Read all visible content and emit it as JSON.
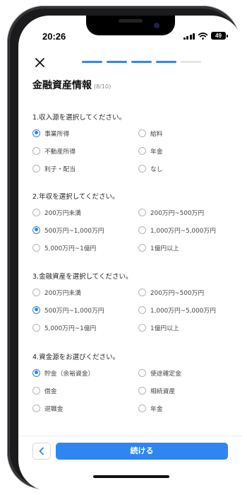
{
  "status_bar": {
    "time": "20:26",
    "battery": "49"
  },
  "header": {
    "title": "金融資産情報",
    "step_counter": "(8/10)",
    "progress": {
      "total_segments": 5,
      "completed_segments": 4
    }
  },
  "colors": {
    "accent": "#2f86f0",
    "segment_inactive": "#e4e4e4"
  },
  "sections": [
    {
      "title": "1.収入源を選択してください。",
      "options": [
        {
          "label": "事業所得",
          "selected": true
        },
        {
          "label": "給料",
          "selected": false
        },
        {
          "label": "不動産所得",
          "selected": false
        },
        {
          "label": "年金",
          "selected": false
        },
        {
          "label": "利子・配当",
          "selected": false
        },
        {
          "label": "なし",
          "selected": false
        }
      ]
    },
    {
      "title": "2.年収を選択してください。",
      "options": [
        {
          "label": "200万円未満",
          "selected": false
        },
        {
          "label": "200万円~500万円",
          "selected": false
        },
        {
          "label": "500万円~1,000万円",
          "selected": true
        },
        {
          "label": "1,000万円~5,000万円",
          "selected": false
        },
        {
          "label": "5,000万円~1億円",
          "selected": false
        },
        {
          "label": "1億円以上",
          "selected": false
        }
      ]
    },
    {
      "title": "3.金融資産を選択してください。",
      "options": [
        {
          "label": "200万円未満",
          "selected": false
        },
        {
          "label": "200万円~500万円",
          "selected": false
        },
        {
          "label": "500万円~1,000万円",
          "selected": true
        },
        {
          "label": "1,000万円~5,000万円",
          "selected": false
        },
        {
          "label": "5,000万円~1億円",
          "selected": false
        },
        {
          "label": "1億円以上",
          "selected": false
        }
      ]
    },
    {
      "title": "4.資金源をお選びください。",
      "options": [
        {
          "label": "貯金（余裕資金）",
          "selected": true
        },
        {
          "label": "使途確定金",
          "selected": false
        },
        {
          "label": "借金",
          "selected": false
        },
        {
          "label": "相続資産",
          "selected": false
        },
        {
          "label": "退職金",
          "selected": false
        },
        {
          "label": "年金",
          "selected": false
        }
      ]
    }
  ],
  "footer": {
    "continue_label": "続ける"
  },
  "icons": {
    "close": "close-icon",
    "back": "chevron-left-icon"
  }
}
